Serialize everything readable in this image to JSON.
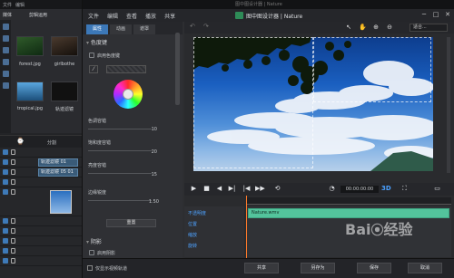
{
  "background_app": {
    "tabs": [
      "媒体",
      "剪辑运用",
      "保持"
    ],
    "media": [
      {
        "name": "forest.jpg"
      },
      {
        "name": "girlbothe"
      },
      {
        "name": "tropical.jpg"
      },
      {
        "name": "轨迹滤镜"
      }
    ],
    "split_label": "分割",
    "clips": [
      "轨迹滤镜 01",
      "轨迹滤镜 05 01"
    ]
  },
  "dialog": {
    "menu": [
      "文件",
      "编辑",
      "查看",
      "播放",
      "共享"
    ],
    "title": "图中图设计器 | Nature",
    "top_strip_text": "图中图设计器 | Nature",
    "tabs": [
      "属性",
      "动画",
      "遮罩"
    ],
    "active_tab": "属性",
    "color_section": "色度键",
    "enable_chroma": "启用色度键",
    "sliders": [
      {
        "label": "色调容错",
        "value": "10"
      },
      {
        "label": "饱和度容错",
        "value": "20"
      },
      {
        "label": "亮度容错",
        "value": "15"
      },
      {
        "label": "边缘锐度",
        "value": "1.50"
      }
    ],
    "reset_label": "重置",
    "shadow_section": "阴影",
    "enable_shadow": "启用阴影",
    "fit_select": "适合...",
    "timecode": "00:00:00:00",
    "three_d": "3D",
    "keyframe_labels": [
      "不透明度",
      "位置",
      "缩放",
      "旋转"
    ],
    "clip_name": "Nature.wmv",
    "bottom_checkbox": "仅显示视频轨道",
    "buttons": {
      "share": "共享",
      "save_as": "另存为",
      "save": "保存",
      "close": "取消"
    }
  },
  "colors": {
    "accent": "#3c78b8",
    "clip": "#53c49c",
    "keyframe_label": "#4ea2ff"
  }
}
